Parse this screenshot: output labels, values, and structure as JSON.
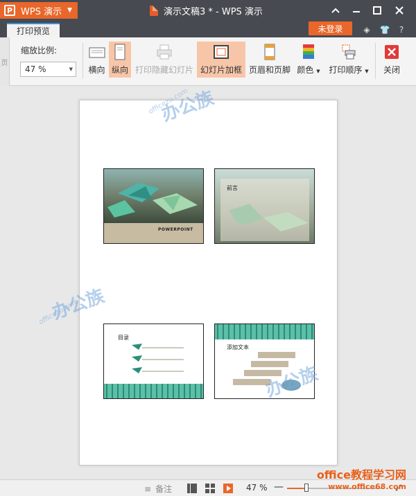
{
  "titlebar": {
    "app_menu_label": "WPS 演示",
    "app_logo": "P",
    "doc_title": "演示文稿3 * - WPS 演示"
  },
  "tabrow": {
    "active_tab": "打印预览",
    "login_label": "未登录"
  },
  "toolbar": {
    "collapsed_tab_char": "页",
    "zoom_label": "缩放比例:",
    "zoom_value": "47 %",
    "landscape": "横向",
    "portrait": "纵向",
    "print_hidden": "打印隐藏幻灯片",
    "frame_slides": "幻灯片加框",
    "header_footer": "页眉和页脚",
    "color": "颜色",
    "print_order": "打印顺序",
    "close": "关闭"
  },
  "slides": {
    "s1_text": "POWERPOINT",
    "s2_title": "前言",
    "s3_title": "目录",
    "s4_title": "添加文本"
  },
  "watermark": {
    "main": "办公族",
    "sub": "officezu.com"
  },
  "statusbar": {
    "notes": "备注",
    "zoom": "47 %",
    "zoom_fraction": 0.47
  },
  "site": {
    "line1": "office教程学习网",
    "line2": "www.office68.com"
  },
  "colors": {
    "accent": "#e9672a",
    "titlebar": "#474a50",
    "active_button": "#f7c6a9"
  }
}
